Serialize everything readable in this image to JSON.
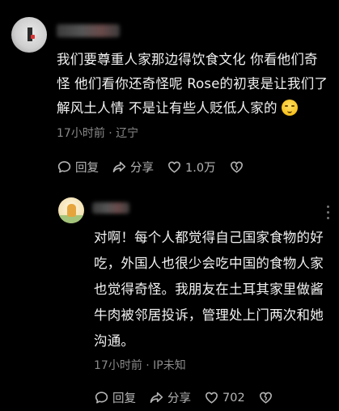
{
  "comment": {
    "text": "我们要尊重人家那边得饮食文化 你看他们奇怪 他们看你还奇怪呢 Rose的初衷是让我们了解风土人情 不是让有些人贬低人家的",
    "emoji_icon": "sweat-smile-emoji-icon",
    "meta": "17小时前 · 辽宁",
    "reply_label": "回复",
    "share_label": "分享",
    "like_count": "1.0万"
  },
  "reply": {
    "text": "对啊！每个人都觉得自己国家食物的好吃，外国人也很少会吃中国的食物人家也觉得奇怪。我朋友在土耳其家里做酱牛肉被邻居投诉，管理处上门两次和她沟通。",
    "meta": "17小时前 · IP未知",
    "reply_label": "回复",
    "share_label": "分享",
    "like_count": "702"
  }
}
